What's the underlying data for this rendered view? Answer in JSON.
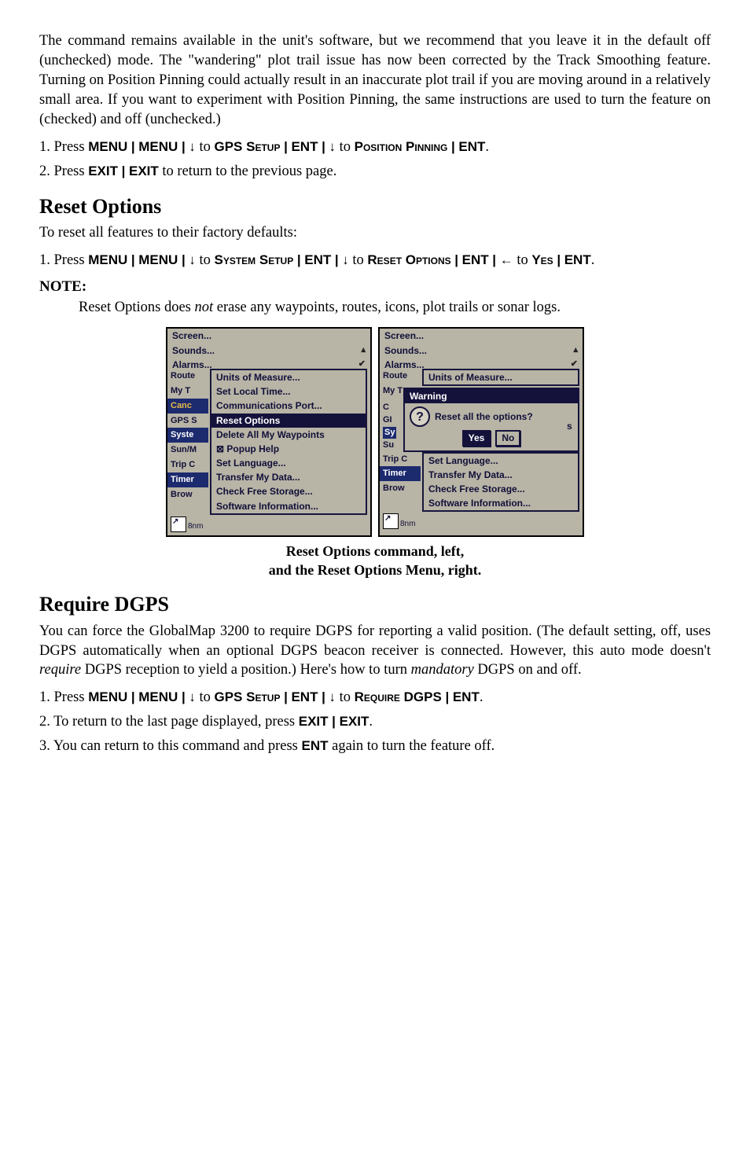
{
  "para1": "The command remains available in the unit's software, but we recommend that you leave it in the default off (unchecked) mode. The \"wandering\" plot trail issue has now been corrected by the Track Smoothing feature. Turning on Position Pinning could actually result in an inaccurate plot trail if you are moving around in a relatively small area. If you want to experiment with Position Pinning, the same instructions are used to turn the feature on (checked) and off (unchecked.)",
  "step1a_pre": "1. Press ",
  "step1a_kbd1": "MENU",
  "sep": "|",
  "step1a_kbd2": "MENU",
  "down": "↓",
  "to": " to ",
  "gps_setup": "GPS Setup",
  "ent": "ENT",
  "pos_pinning": "Position Pinning",
  "period": ".",
  "step2_pre": "2. Press ",
  "exit": "EXIT",
  "step2_post": " to return to the previous page.",
  "h_reset": "Reset Options",
  "reset_intro": "To reset all features to their factory defaults:",
  "reset_step_pre": "1. Press ",
  "system_setup": "System Setup",
  "reset_options": "Reset Options",
  "left": "←",
  "yes": "Yes",
  "reset_step_end": ".",
  "note_label": "NOTE:",
  "note_body_a": "Reset Options does ",
  "note_body_not": "not",
  "note_body_b": " erase any waypoints, routes, icons, plot trails or sonar logs.",
  "caption1": "Reset Options command, left,",
  "caption2": "and the Reset Options Menu, right.",
  "h_dgps": "Require DGPS",
  "dgps_para_a": "You can force the GlobalMap 3200 to require DGPS for reporting a valid position. (The default setting, off, uses DGPS automatically when an optional DGPS beacon receiver is connected. However, this auto mode doesn't ",
  "dgps_para_req": "require",
  "dgps_para_b": " DGPS reception to yield a position.) Here's how to turn ",
  "dgps_para_man": "mandatory",
  "dgps_para_c": " DGPS on and off.",
  "dgps_step1_pre": "1. Press ",
  "require_dgps": "Require DGPS",
  "dgps_step2_pre": "2. To return to the last page displayed, press ",
  "dgps_step3_a": "3. You can return to this command and press ",
  "dgps_step3_b": " again to turn the feature off.",
  "menu_left": {
    "top": [
      "Screen...",
      "Sounds...",
      "Alarms..."
    ],
    "side": [
      "Route",
      "My T",
      "Canc",
      "GPS S",
      "Syste",
      "Sun/M",
      "Trip C",
      "Timer",
      "Brow"
    ],
    "sub": [
      "Units of Measure...",
      "Set Local Time...",
      "Communications Port...",
      "Reset Options",
      "Delete All My Waypoints",
      "Popup Help",
      "Set Language...",
      "Transfer My Data...",
      "Check Free Storage...",
      "Software Information..."
    ],
    "popup_prefix": "⊠",
    "range": "8nm"
  },
  "menu_right": {
    "top": [
      "Screen...",
      "Sounds...",
      "Alarms..."
    ],
    "side": [
      "Route",
      "My T"
    ],
    "sub_top": "Units of Measure...",
    "warn_title": "Warning",
    "warn_text": "Reset all the options?",
    "warn_yes": "Yes",
    "warn_no": "No",
    "side_low": [
      "Trip C",
      "Timer",
      "Brow"
    ],
    "sub_low": [
      "Set Language...",
      "Transfer My Data...",
      "Check Free Storage...",
      "Software Information..."
    ],
    "range": "8nm",
    "partial_letters": {
      "g": "GI",
      "s1": "Sy",
      "s2": "Su",
      "c": "C",
      "tail": "s"
    }
  }
}
